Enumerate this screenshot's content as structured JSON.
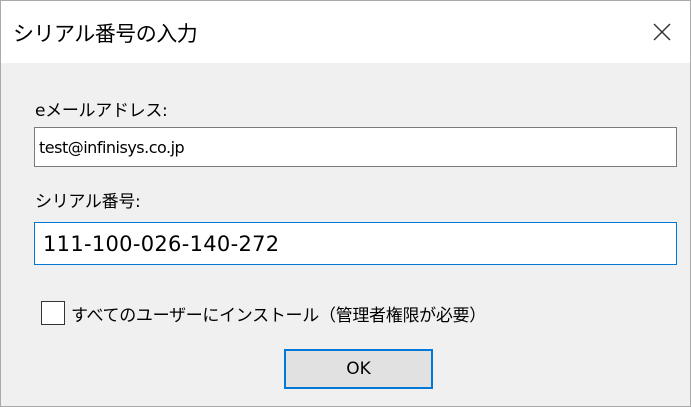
{
  "window": {
    "title": "シリアル番号の入力",
    "close_icon": "close-icon"
  },
  "form": {
    "email_label": "eメールアドレス:",
    "email_value": "test@infinisys.co.jp",
    "serial_label": "シリアル番号:",
    "serial_value": "111-100-026-140-272",
    "all_users_checkbox_label": "すべてのユーザーにインストール（管理者権限が必要）",
    "all_users_checked": false,
    "ok_label": "OK"
  },
  "colors": {
    "dialog_background": "#f0f0f0",
    "titlebar_background": "#ffffff",
    "focus_border": "#0078d7",
    "button_background": "#e1e1e1"
  }
}
